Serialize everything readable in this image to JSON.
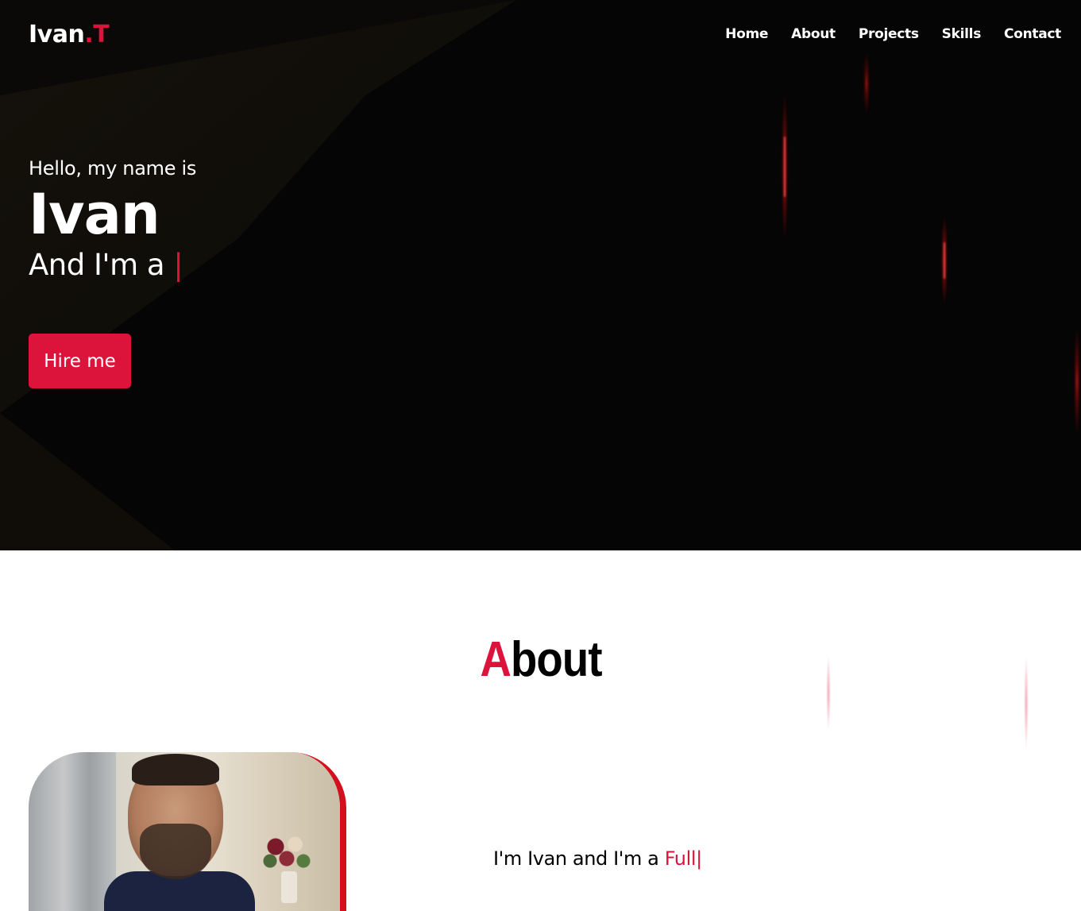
{
  "navbar": {
    "logo_main": "Ivan",
    "logo_accent": ".T",
    "links": [
      "Home",
      "About",
      "Projects",
      "Skills",
      "Contact"
    ]
  },
  "hero": {
    "greeting": "Hello, my name is",
    "name": "Ivan",
    "role_prefix": "And I'm a",
    "cursor": "|",
    "hire_button": "Hire me"
  },
  "about": {
    "title_first": "A",
    "title_rest": "bout",
    "heading_prefix": "I'm Ivan and I'm a",
    "heading_role": "Full",
    "cursor": "|"
  },
  "colors": {
    "accent": "#dc143c",
    "hero_bg": "#050505",
    "text_light": "#ffffff"
  }
}
